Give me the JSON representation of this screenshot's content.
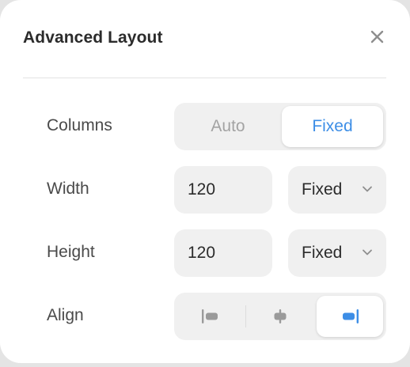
{
  "dialog": {
    "title": "Advanced Layout",
    "close_icon": "close-icon"
  },
  "columns": {
    "label": "Columns",
    "options": [
      "Auto",
      "Fixed"
    ],
    "selected": "Fixed"
  },
  "width": {
    "label": "Width",
    "value": "120",
    "mode": "Fixed"
  },
  "height": {
    "label": "Height",
    "value": "120",
    "mode": "Fixed"
  },
  "align": {
    "label": "Align",
    "options": [
      "align-left-icon",
      "align-center-icon",
      "align-right-icon"
    ],
    "selected": "align-right-icon"
  },
  "colors": {
    "accent": "#3d8ee6",
    "inactive_icon": "#9a9a9a"
  }
}
